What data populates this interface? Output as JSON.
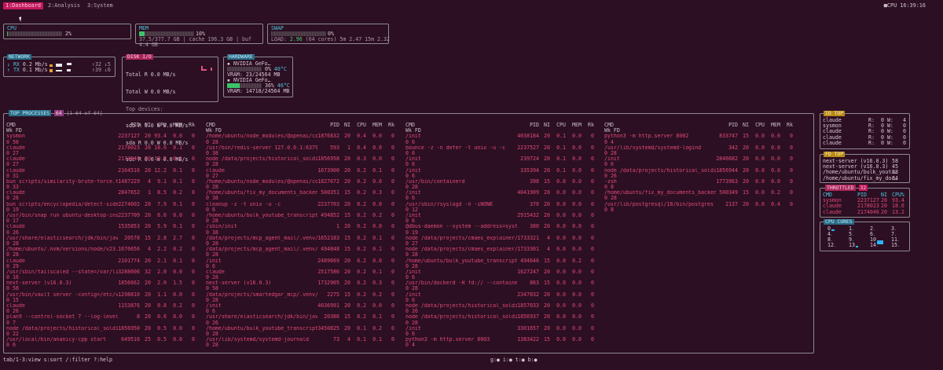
{
  "tabs": [
    {
      "label": "1:Dashboard",
      "active": true
    },
    {
      "label": "2:Analysis"
    },
    {
      "label": "3:System"
    }
  ],
  "clock": "■CPU 16:39:16",
  "cpu": {
    "title": "CPU",
    "percent_text": "2%",
    "percent": 2
  },
  "mem": {
    "title": "MEM",
    "percent_text": "10%",
    "percent": 10,
    "detail": "37.5/377.7 GB | cache 196.3 GB | buf 4.4 GB"
  },
  "swap": {
    "title": "SWAP",
    "percent_text": "0%",
    "percent": 0,
    "load_prefix": "LOAD:",
    "load_value": "2.96",
    "load_rest": "(64 cores) 5m 2.47 15m 2.32"
  },
  "network": {
    "title": "NETWORK",
    "rx_label": "↓ RX",
    "rx_value": "0.2 Mb/s",
    "rx_total": "↑32 ↓5",
    "tx_label": "↑ TX",
    "tx_value": "0.1 Mb/s",
    "tx_total": "↑39 ↓6"
  },
  "disk": {
    "title": "DISK I/O",
    "lines": [
      "Total R   0.0 MB/s",
      "Total W   0.0 MB/s",
      "Top devices:",
      "sdb    R  0.0 W  0.0 MB/s",
      "sda    R  0.0 W  0.0 MB/s",
      "sdc    R  0.0 W  0.0 MB/s"
    ]
  },
  "hardware": {
    "title": "HARDWARE",
    "gpus": [
      {
        "name": "▪ NVIDIA GeFo…",
        "util": "0%",
        "temp": "40°C",
        "vram": "VRAM:  23/24564 MB",
        "util_pct": 0
      },
      {
        "name": "▪ NVIDIA GeFo…",
        "util": "36%",
        "temp": "46°C",
        "vram": "VRAM: 14718/24564 MB",
        "util_pct": 36
      }
    ]
  },
  "processes": {
    "title": "TOP PROCESSES",
    "count": "64",
    "range": "[1-64 of 64]",
    "headers": {
      "cmd": "CMD",
      "pid": "PID",
      "ni": "NI",
      "cpu": "CPU",
      "mem": "MEM",
      "rk": "Rk",
      "sub": "Wk  FD"
    },
    "columns": [
      [
        {
          "cmd": "sysmon",
          "pid": "2237127",
          "ni": "20",
          "cpu": "93.4",
          "mem": "0.0",
          "rk": "0",
          "sub": "0  50"
        },
        {
          "cmd": "claude",
          "pid": "2178023",
          "ni": "20",
          "cpu": "18.6",
          "mem": "0.1",
          "rk": "0",
          "sub": "0  27"
        },
        {
          "cmd": "claude",
          "pid": "2174046",
          "ni": "20",
          "cpu": "13.2",
          "mem": "0.1",
          "rk": "0",
          "sub": "0  27"
        },
        {
          "cmd": "claude",
          "pid": "2164516",
          "ni": "20",
          "cpu": "12.2",
          "mem": "0.1",
          "rk": "0",
          "sub": "0  31"
        },
        {
          "cmd": "bun scripts/similarity-brute-force.ts",
          "pid": "1487229",
          "ni": "4",
          "cpu": "9.1",
          "mem": "0.1",
          "rk": "0",
          "sub": "0  33"
        },
        {
          "cmd": "claude",
          "pid": "2847652",
          "ni": "1",
          "cpu": "8.5",
          "mem": "0.2",
          "rk": "0",
          "sub": "0  26"
        },
        {
          "cmd": "bun scripts/encyclopedia/detect-sidebar-por…",
          "pid": "2274602",
          "ni": "20",
          "cpu": "7.9",
          "mem": "0.1",
          "rk": "0",
          "sub": "0  19"
        },
        {
          "cmd": "/usr/bin/snap run ubuntu-desktop-installer…",
          "pid": "2237709",
          "ni": "20",
          "cpu": "6.6",
          "mem": "0.0",
          "rk": "0",
          "sub": "0  17"
        },
        {
          "cmd": "claude",
          "pid": "1535853",
          "ni": "20",
          "cpu": "5.9",
          "mem": "0.1",
          "rk": "0",
          "sub": "0  26"
        },
        {
          "cmd": "/usr/share/elasticsearch/jdk/bin/java -Des…",
          "pid": "20578",
          "ni": "15",
          "cpu": "2.8",
          "mem": "2.7",
          "rk": "0",
          "sub": "0  28"
        },
        {
          "cmd": "/home/ubuntu/.nvm/versions/node/v23.5.0/bin…",
          "pid": "1676656",
          "ni": "4",
          "cpu": "2.2",
          "mem": "0.2",
          "rk": "0",
          "sub": "0  28"
        },
        {
          "cmd": "claude",
          "pid": "2101774",
          "ni": "20",
          "cpu": "2.1",
          "mem": "0.1",
          "rk": "0",
          "sub": "0  29"
        },
        {
          "cmd": "/usr/sbin/tailscaled --state=/var/lib/tails…",
          "pid": "3288606",
          "ni": "32",
          "cpu": "2.0",
          "mem": "0.0",
          "rk": "0",
          "sub": "0  16"
        },
        {
          "cmd": "next-server (v16.0.3)",
          "pid": "1856662",
          "ni": "20",
          "cpu": "2.0",
          "mem": "1.5",
          "rk": "0",
          "sub": "0  58"
        },
        {
          "cmd": "/usr/bin/vault server -config=/etc/vault.d/…",
          "pid": "1298810",
          "ni": "20",
          "cpu": "1.1",
          "mem": "0.0",
          "rk": "0",
          "sub": "0  15"
        },
        {
          "cmd": "claude",
          "pid": "1153876",
          "ni": "20",
          "cpu": "0.8",
          "mem": "0.2",
          "rk": "0",
          "sub": "0  26"
        },
        {
          "cmd": "plan9 --control-socket 7 --log-level 4 --se…",
          "pid": "8",
          "ni": "20",
          "cpu": "0.6",
          "mem": "0.0",
          "rk": "0",
          "sub": "0  7"
        },
        {
          "cmd": "node /data/projects/historical_soldiers/.ne…",
          "pid": "1856950",
          "ni": "20",
          "cpu": "0.5",
          "mem": "0.0",
          "rk": "0",
          "sub": "0  22"
        },
        {
          "cmd": "/usr/local/bin/ananicy-cpp start",
          "pid": "649516",
          "ni": "25",
          "cpu": "0.5",
          "mem": "0.0",
          "rk": "0",
          "sub": "0  6"
        }
      ],
      [
        {
          "cmd": "/home/ubuntu/node_modules/@openai/codex/ven…",
          "pid": "1876832",
          "ni": "20",
          "cpu": "0.4",
          "mem": "0.0",
          "rk": "0",
          "sub": "0  28"
        },
        {
          "cmd": "/usr/bin/redis-server 127.0.0.1:6379",
          "pid": "593",
          "ni": "1",
          "cpu": "0.4",
          "mem": "0.0",
          "rk": "0",
          "sub": "0  38"
        },
        {
          "cmd": "node /data/projects/historical_soldiers/.ne…",
          "pid": "1856958",
          "ni": "20",
          "cpu": "0.3",
          "mem": "0.0",
          "rk": "0",
          "sub": "0  28"
        },
        {
          "cmd": "claude",
          "pid": "1673900",
          "ni": "20",
          "cpu": "0.2",
          "mem": "0.1",
          "rk": "0",
          "sub": "0  27"
        },
        {
          "cmd": "/home/ubuntu/node_modules/@openai/codex/ven…",
          "pid": "1827672",
          "ni": "20",
          "cpu": "0.2",
          "mem": "0.0",
          "rk": "0",
          "sub": "0  28"
        },
        {
          "cmd": "/home/ubuntu/fix_my_documents_backend/.venv…",
          "pid": "500351",
          "ni": "15",
          "cpu": "0.2",
          "mem": "0.3",
          "rk": "0",
          "sub": "0  38"
        },
        {
          "cmd": "cleanup -z -t unix -u -c",
          "pid": "2237703",
          "ni": "20",
          "cpu": "0.2",
          "mem": "0.0",
          "rk": "0",
          "sub": "0  6"
        },
        {
          "cmd": "/home/ubuntu/bulk_youtube_transcript_optimi…",
          "pid": "494852",
          "ni": "15",
          "cpu": "0.2",
          "mem": "0.2",
          "rk": "0",
          "sub": "0  28"
        },
        {
          "cmd": "/sbin/init",
          "pid": "1",
          "ni": "20",
          "cpu": "0.2",
          "mem": "0.0",
          "rk": "0",
          "sub": "0  38"
        },
        {
          "cmd": "/data/projects/mcp_agent_mail/.venv/bin/pyt…",
          "pid": "1652183",
          "ni": "15",
          "cpu": "0.2",
          "mem": "0.1",
          "rk": "0",
          "sub": "0  28"
        },
        {
          "cmd": "/data/projects/mcp_agent_mail/.venv/bin/pyt…",
          "pid": "494848",
          "ni": "15",
          "cpu": "0.2",
          "mem": "0.1",
          "rk": "0",
          "sub": "0  28"
        },
        {
          "cmd": "/init",
          "pid": "2489669",
          "ni": "20",
          "cpu": "0.2",
          "mem": "0.0",
          "rk": "0",
          "sub": "0  6"
        },
        {
          "cmd": "claude",
          "pid": "2517586",
          "ni": "20",
          "cpu": "0.2",
          "mem": "0.1",
          "rk": "0",
          "sub": "0  28"
        },
        {
          "cmd": "next-server (v16.0.3)",
          "pid": "1732905",
          "ni": "20",
          "cpu": "0.2",
          "mem": "0.3",
          "rk": "0",
          "sub": "0  58"
        },
        {
          "cmd": "/data/projects/smartedgar_mcp/.venv/bin/pyt…",
          "pid": "2275",
          "ni": "15",
          "cpu": "0.2",
          "mem": "0.2",
          "rk": "0",
          "sub": "0  28"
        },
        {
          "cmd": "/init",
          "pid": "4036991",
          "ni": "20",
          "cpu": "0.2",
          "mem": "0.0",
          "rk": "0",
          "sub": "0  6"
        },
        {
          "cmd": "/usr/share/elasticsearch/jdk/bin/java -Xms4…",
          "pid": "20386",
          "ni": "15",
          "cpu": "0.2",
          "mem": "0.1",
          "rk": "0",
          "sub": "0  26"
        },
        {
          "cmd": "/home/ubuntu/bulk_youtube_transcript_optimi…",
          "pid": "3450825",
          "ni": "20",
          "cpu": "0.1",
          "mem": "0.2",
          "rk": "0",
          "sub": "0  28"
        },
        {
          "cmd": "/usr/lib/systemd/systemd-journald",
          "pid": "73",
          "ni": "4",
          "cpu": "0.1",
          "mem": "0.1",
          "rk": "0",
          "sub": "0  28"
        }
      ],
      [
        {
          "cmd": "/init",
          "pid": "4038184",
          "ni": "20",
          "cpu": "0.1",
          "mem": "0.0",
          "rk": "0",
          "sub": "0  6"
        },
        {
          "cmd": "bounce -z -n defer -t unix -u -c",
          "pid": "2237527",
          "ni": "20",
          "cpu": "0.1",
          "mem": "0.0",
          "rk": "0",
          "sub": "0  6"
        },
        {
          "cmd": "/init",
          "pid": "239724",
          "ni": "20",
          "cpu": "0.1",
          "mem": "0.0",
          "rk": "0",
          "sub": "0  6"
        },
        {
          "cmd": "/init",
          "pid": "335394",
          "ni": "20",
          "cpu": "0.1",
          "mem": "0.0",
          "rk": "0",
          "sub": "0  6"
        },
        {
          "cmd": "/usr/bin/containerd",
          "pid": "398",
          "ni": "15",
          "cpu": "0.0",
          "mem": "0.0",
          "rk": "0",
          "sub": "0  28"
        },
        {
          "cmd": "/init",
          "pid": "4041909",
          "ni": "20",
          "cpu": "0.0",
          "mem": "0.0",
          "rk": "0",
          "sub": "0  6"
        },
        {
          "cmd": "/usr/sbin/rsyslogd -n -iNONE",
          "pid": "370",
          "ni": "20",
          "cpu": "0.0",
          "mem": "0.0",
          "rk": "0",
          "sub": "0  12"
        },
        {
          "cmd": "/init",
          "pid": "2915432",
          "ni": "20",
          "cpu": "0.0",
          "mem": "0.0",
          "rk": "0",
          "sub": "0  6"
        },
        {
          "cmd": "@dbus-daemon --system --address=systemd: --…",
          "pid": "380",
          "ni": "20",
          "cpu": "0.0",
          "mem": "0.0",
          "rk": "0",
          "sub": "0  19"
        },
        {
          "cmd": "node /data/projects/cmaes_explainer/.next/d…",
          "pid": "1733321",
          "ni": "4",
          "cpu": "0.0",
          "mem": "0.0",
          "rk": "0",
          "sub": "0  27"
        },
        {
          "cmd": "node /data/projects/cmaes_explainer/.next/d…",
          "pid": "1733301",
          "ni": "4",
          "cpu": "0.0",
          "mem": "0.0",
          "rk": "0",
          "sub": "0  28"
        },
        {
          "cmd": "/home/ubuntu/bulk_youtube_transcript_optimi…",
          "pid": "494646",
          "ni": "15",
          "cpu": "0.0",
          "mem": "0.2",
          "rk": "0",
          "sub": "0  28"
        },
        {
          "cmd": "/init",
          "pid": "1627247",
          "ni": "20",
          "cpu": "0.0",
          "mem": "0.0",
          "rk": "0",
          "sub": "0  6"
        },
        {
          "cmd": "/usr/bin/dockerd -H fd:// --containerd=/run…",
          "pid": "863",
          "ni": "15",
          "cpu": "0.0",
          "mem": "0.0",
          "rk": "0",
          "sub": "0  28"
        },
        {
          "cmd": "/init",
          "pid": "2347832",
          "ni": "20",
          "cpu": "0.0",
          "mem": "0.0",
          "rk": "0",
          "sub": "0  6"
        },
        {
          "cmd": "node /data/projects/historical_soldiers/.ne…",
          "pid": "1857033",
          "ni": "20",
          "cpu": "0.0",
          "mem": "0.0",
          "rk": "0",
          "sub": "0  26"
        },
        {
          "cmd": "node /data/projects/historical_soldiers/.ne…",
          "pid": "1856937",
          "ni": "20",
          "cpu": "0.0",
          "mem": "0.0",
          "rk": "0",
          "sub": "0  28"
        },
        {
          "cmd": "/init",
          "pid": "3301657",
          "ni": "20",
          "cpu": "0.0",
          "mem": "0.0",
          "rk": "0",
          "sub": "0  6"
        },
        {
          "cmd": "python3 -m http.server 8003",
          "pid": "1383422",
          "ni": "15",
          "cpu": "0.0",
          "mem": "0.0",
          "rk": "0",
          "sub": "0  4"
        }
      ],
      [
        {
          "cmd": "python3 -m http.server 8002",
          "pid": "833747",
          "ni": "15",
          "cpu": "0.0",
          "mem": "0.0",
          "rk": "0",
          "sub": "0  4"
        },
        {
          "cmd": "/usr/lib/systemd/systemd-logind",
          "pid": "342",
          "ni": "20",
          "cpu": "0.0",
          "mem": "0.0",
          "rk": "0",
          "sub": "0  28"
        },
        {
          "cmd": "/init",
          "pid": "2846682",
          "ni": "20",
          "cpu": "0.0",
          "mem": "0.0",
          "rk": "0",
          "sub": "0  6"
        },
        {
          "cmd": "node /data/projects/historical_soldiers/.ne…",
          "pid": "1856944",
          "ni": "20",
          "cpu": "0.0",
          "mem": "0.0",
          "rk": "0",
          "sub": "0  26"
        },
        {
          "cmd": "-zsh",
          "pid": "1773963",
          "ni": "20",
          "cpu": "0.0",
          "mem": "0.0",
          "rk": "0",
          "sub": "0  8"
        },
        {
          "cmd": "/home/ubuntu/fix_my_documents_backend/.venv…",
          "pid": "500349",
          "ni": "15",
          "cpu": "0.0",
          "mem": "0.2",
          "rk": "0",
          "sub": "0  28"
        },
        {
          "cmd": "/usr/lib/postgresql/18/bin/postgres -D /var…",
          "pid": "2137",
          "ni": "20",
          "cpu": "0.0",
          "mem": "0.4",
          "rk": "0",
          "sub": "0  8"
        }
      ]
    ]
  },
  "io_top": {
    "title": "IO TOP",
    "rows": [
      [
        "claude",
        "R:",
        "0 W:",
        "4"
      ],
      [
        "sysmon",
        "R:",
        "0 W:",
        "0"
      ],
      [
        "claude",
        "R:",
        "0 W:",
        "0"
      ],
      [
        "claude",
        "R:",
        "0 W:",
        "0"
      ],
      [
        "claude",
        "R:",
        "0 W:",
        "0"
      ]
    ]
  },
  "fd_top": {
    "title": "FD TOP",
    "rows": [
      [
        "next-server (v16.0.3)",
        "58"
      ],
      [
        "next-server (v16.0.3)",
        "45"
      ],
      [
        "/home/ubuntu/bulk_youtu…",
        "38"
      ],
      [
        "/home/ubuntu/fix_my_doc…",
        "34"
      ]
    ]
  },
  "throttled": {
    "title": "THROTTLED",
    "count": "32",
    "headers": [
      "CMD",
      "PID",
      "NI",
      "CPU%"
    ],
    "rows": [
      [
        "sysmon",
        "2237127",
        "20",
        "93.4"
      ],
      [
        "claude",
        "2178023",
        "20",
        "18.6"
      ],
      [
        "claude",
        "2174046",
        "20",
        "13.2"
      ]
    ]
  },
  "cpu_cores": {
    "title": "CPU CORES",
    "labels": [
      "0",
      "1",
      "2",
      "3",
      "4",
      "5",
      "6",
      "7",
      "8",
      "9",
      "10",
      "11",
      "12",
      "13",
      "14",
      "15"
    ],
    "values": [
      55,
      0,
      0,
      0,
      0,
      0,
      0,
      0,
      0,
      0,
      100,
      0,
      0,
      40,
      0,
      0
    ]
  },
  "footer": {
    "left": "tab/1-3:view  s:sort  /:filter  ?:help",
    "mid": "g:● i:● t:● b:●"
  }
}
